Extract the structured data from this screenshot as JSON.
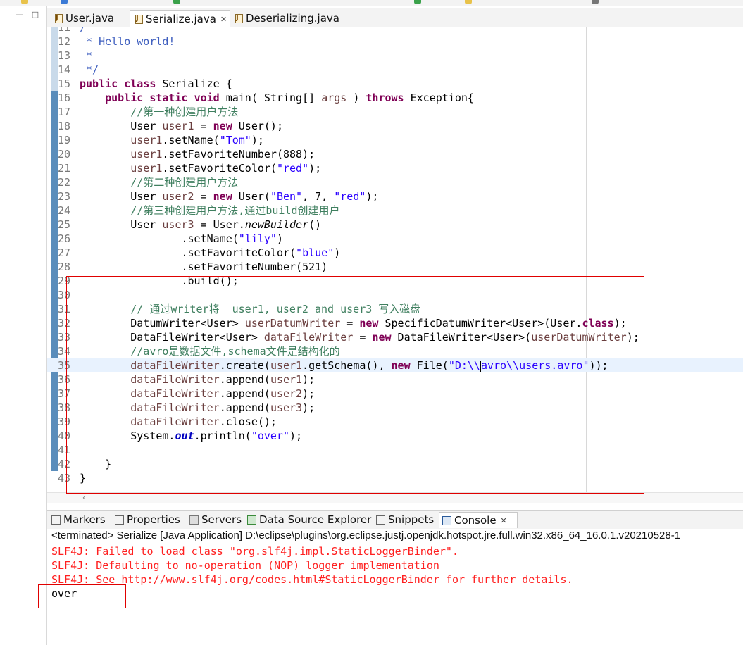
{
  "editor_tabs": [
    {
      "label": "User.java",
      "active": false
    },
    {
      "label": "Serialize.java",
      "active": true
    },
    {
      "label": "Deserializing.java",
      "active": false
    }
  ],
  "view_tabs": [
    {
      "label": "Markers",
      "icon": "markers-icon"
    },
    {
      "label": "Properties",
      "icon": "properties-icon"
    },
    {
      "label": "Servers",
      "icon": "servers-icon"
    },
    {
      "label": "Data Source Explorer",
      "icon": "data-source-explorer-icon"
    },
    {
      "label": "Snippets",
      "icon": "snippets-icon"
    },
    {
      "label": "Console",
      "icon": "console-icon",
      "active": true
    }
  ],
  "code_lines": [
    {
      "n": "11",
      "segs": [
        [
          "jd",
          "/*"
        ]
      ]
    },
    {
      "n": "12",
      "segs": [
        [
          "jd",
          " * Hello world!"
        ]
      ]
    },
    {
      "n": "13",
      "segs": [
        [
          "jd",
          " *"
        ]
      ]
    },
    {
      "n": "14",
      "segs": [
        [
          "jd",
          " */"
        ]
      ]
    },
    {
      "n": "15",
      "segs": [
        [
          "kw",
          "public"
        ],
        [
          "",
          " "
        ],
        [
          "kw",
          "class"
        ],
        [
          "",
          " Serialize {"
        ]
      ]
    },
    {
      "n": "16",
      "segs": [
        [
          "",
          "    "
        ],
        [
          "kw",
          "public"
        ],
        [
          "",
          " "
        ],
        [
          "kw",
          "static"
        ],
        [
          "",
          " "
        ],
        [
          "kw",
          "void"
        ],
        [
          "",
          " main( String[] "
        ],
        [
          "var",
          "args"
        ],
        [
          "",
          " ) "
        ],
        [
          "kw",
          "throws"
        ],
        [
          "",
          " Exception{"
        ]
      ]
    },
    {
      "n": "17",
      "segs": [
        [
          "",
          "        "
        ],
        [
          "cm",
          "//第一种创建用户方法"
        ]
      ]
    },
    {
      "n": "18",
      "segs": [
        [
          "",
          "        User "
        ],
        [
          "var",
          "user1"
        ],
        [
          "",
          " = "
        ],
        [
          "kw",
          "new"
        ],
        [
          "",
          " User();"
        ]
      ]
    },
    {
      "n": "19",
      "segs": [
        [
          "",
          "        "
        ],
        [
          "var",
          "user1"
        ],
        [
          "",
          ".setName("
        ],
        [
          "st",
          "\"Tom\""
        ],
        [
          "",
          ");"
        ]
      ]
    },
    {
      "n": "20",
      "segs": [
        [
          "",
          "        "
        ],
        [
          "var",
          "user1"
        ],
        [
          "",
          ".setFavoriteNumber(888);"
        ]
      ]
    },
    {
      "n": "21",
      "segs": [
        [
          "",
          "        "
        ],
        [
          "var",
          "user1"
        ],
        [
          "",
          ".setFavoriteColor("
        ],
        [
          "st",
          "\"red\""
        ],
        [
          "",
          ");"
        ]
      ]
    },
    {
      "n": "22",
      "segs": [
        [
          "",
          "        "
        ],
        [
          "cm",
          "//第二种创建用户方法"
        ]
      ]
    },
    {
      "n": "23",
      "segs": [
        [
          "",
          "        User "
        ],
        [
          "var",
          "user2"
        ],
        [
          "",
          " = "
        ],
        [
          "kw",
          "new"
        ],
        [
          "",
          " User("
        ],
        [
          "st",
          "\"Ben\""
        ],
        [
          "",
          ", 7, "
        ],
        [
          "st",
          "\"red\""
        ],
        [
          "",
          ");"
        ]
      ]
    },
    {
      "n": "24",
      "segs": [
        [
          "",
          "        "
        ],
        [
          "cm",
          "//第三种创建用户方法,通过build创建用户"
        ]
      ]
    },
    {
      "n": "25",
      "segs": [
        [
          "",
          "        User "
        ],
        [
          "var",
          "user3"
        ],
        [
          "",
          " = User."
        ],
        [
          "mi",
          "newBuilder"
        ],
        [
          "",
          "()"
        ]
      ]
    },
    {
      "n": "26",
      "segs": [
        [
          "",
          "                .setName("
        ],
        [
          "st",
          "\"lily\""
        ],
        [
          "",
          ")"
        ]
      ]
    },
    {
      "n": "27",
      "segs": [
        [
          "",
          "                .setFavoriteColor("
        ],
        [
          "st",
          "\"blue\""
        ],
        [
          "",
          ")"
        ]
      ]
    },
    {
      "n": "28",
      "segs": [
        [
          "",
          "                .setFavoriteNumber(521)"
        ]
      ]
    },
    {
      "n": "29",
      "segs": [
        [
          "",
          "                .build();"
        ]
      ]
    },
    {
      "n": "30",
      "segs": [
        [
          "",
          ""
        ]
      ]
    },
    {
      "n": "31",
      "segs": [
        [
          "",
          "        "
        ],
        [
          "cm",
          "// 通过writer将  user1, user2 and user3 写入磁盘"
        ]
      ]
    },
    {
      "n": "32",
      "segs": [
        [
          "",
          "        DatumWriter<User> "
        ],
        [
          "var",
          "userDatumWriter"
        ],
        [
          "",
          " = "
        ],
        [
          "kw",
          "new"
        ],
        [
          "",
          " SpecificDatumWriter<User>(User."
        ],
        [
          "kw",
          "class"
        ],
        [
          "",
          ");"
        ]
      ]
    },
    {
      "n": "33",
      "segs": [
        [
          "",
          "        DataFileWriter<User> "
        ],
        [
          "var",
          "dataFileWriter"
        ],
        [
          "",
          " = "
        ],
        [
          "kw",
          "new"
        ],
        [
          "",
          " DataFileWriter<User>("
        ],
        [
          "var",
          "userDatumWriter"
        ],
        [
          "",
          ");"
        ]
      ]
    },
    {
      "n": "34",
      "segs": [
        [
          "",
          "        "
        ],
        [
          "cm",
          "//avro是数据文件,schema文件是结构化的"
        ]
      ]
    },
    {
      "n": "35",
      "segs": [
        [
          "",
          "        "
        ],
        [
          "var",
          "dataFileWriter"
        ],
        [
          "",
          ".create("
        ],
        [
          "var",
          "user1"
        ],
        [
          "",
          ".getSchema(), "
        ],
        [
          "kw",
          "new"
        ],
        [
          "",
          " File("
        ],
        [
          "st",
          "\"D:\\\\"
        ],
        [
          "caret",
          ""
        ],
        [
          "st",
          "avro\\\\users.avro\""
        ],
        [
          "",
          "));"
        ]
      ],
      "hl": true
    },
    {
      "n": "36",
      "segs": [
        [
          "",
          "        "
        ],
        [
          "var",
          "dataFileWriter"
        ],
        [
          "",
          ".append("
        ],
        [
          "var",
          "user1"
        ],
        [
          "",
          ");"
        ]
      ]
    },
    {
      "n": "37",
      "segs": [
        [
          "",
          "        "
        ],
        [
          "var",
          "dataFileWriter"
        ],
        [
          "",
          ".append("
        ],
        [
          "var",
          "user2"
        ],
        [
          "",
          ");"
        ]
      ]
    },
    {
      "n": "38",
      "segs": [
        [
          "",
          "        "
        ],
        [
          "var",
          "dataFileWriter"
        ],
        [
          "",
          ".append("
        ],
        [
          "var",
          "user3"
        ],
        [
          "",
          ");"
        ]
      ]
    },
    {
      "n": "39",
      "segs": [
        [
          "",
          "        "
        ],
        [
          "var",
          "dataFileWriter"
        ],
        [
          "",
          ".close();"
        ]
      ]
    },
    {
      "n": "40",
      "segs": [
        [
          "",
          "        System."
        ],
        [
          "fld",
          "out"
        ],
        [
          "",
          ".println("
        ],
        [
          "st",
          "\"over\""
        ],
        [
          "",
          ");"
        ]
      ]
    },
    {
      "n": "41",
      "segs": [
        [
          "",
          ""
        ]
      ]
    },
    {
      "n": "42",
      "segs": [
        [
          "",
          "    }"
        ]
      ]
    },
    {
      "n": "43",
      "segs": [
        [
          "",
          "}"
        ]
      ]
    }
  ],
  "console": {
    "terminated": "<terminated> Serialize [Java Application] D:\\eclipse\\plugins\\org.eclipse.justj.openjdk.hotspot.jre.full.win32.x86_64_16.0.1.v20210528-1",
    "lines": [
      {
        "text": "SLF4J: Failed to load class \"org.slf4j.impl.StaticLoggerBinder\".",
        "type": "err"
      },
      {
        "text": "SLF4J: Defaulting to no-operation (NOP) logger implementation",
        "type": "err"
      },
      {
        "text": "SLF4J: See http://www.slf4j.org/codes.html#StaticLoggerBinder for further details.",
        "type": "err"
      },
      {
        "text": "over",
        "type": "out"
      }
    ]
  },
  "colors": {
    "keyword": "#7f0055",
    "comment": "#3f7f5f",
    "javadoc": "#3f5fbf",
    "string": "#2a00ff",
    "error": "#ff2020",
    "annotation_box": "#e00000"
  }
}
